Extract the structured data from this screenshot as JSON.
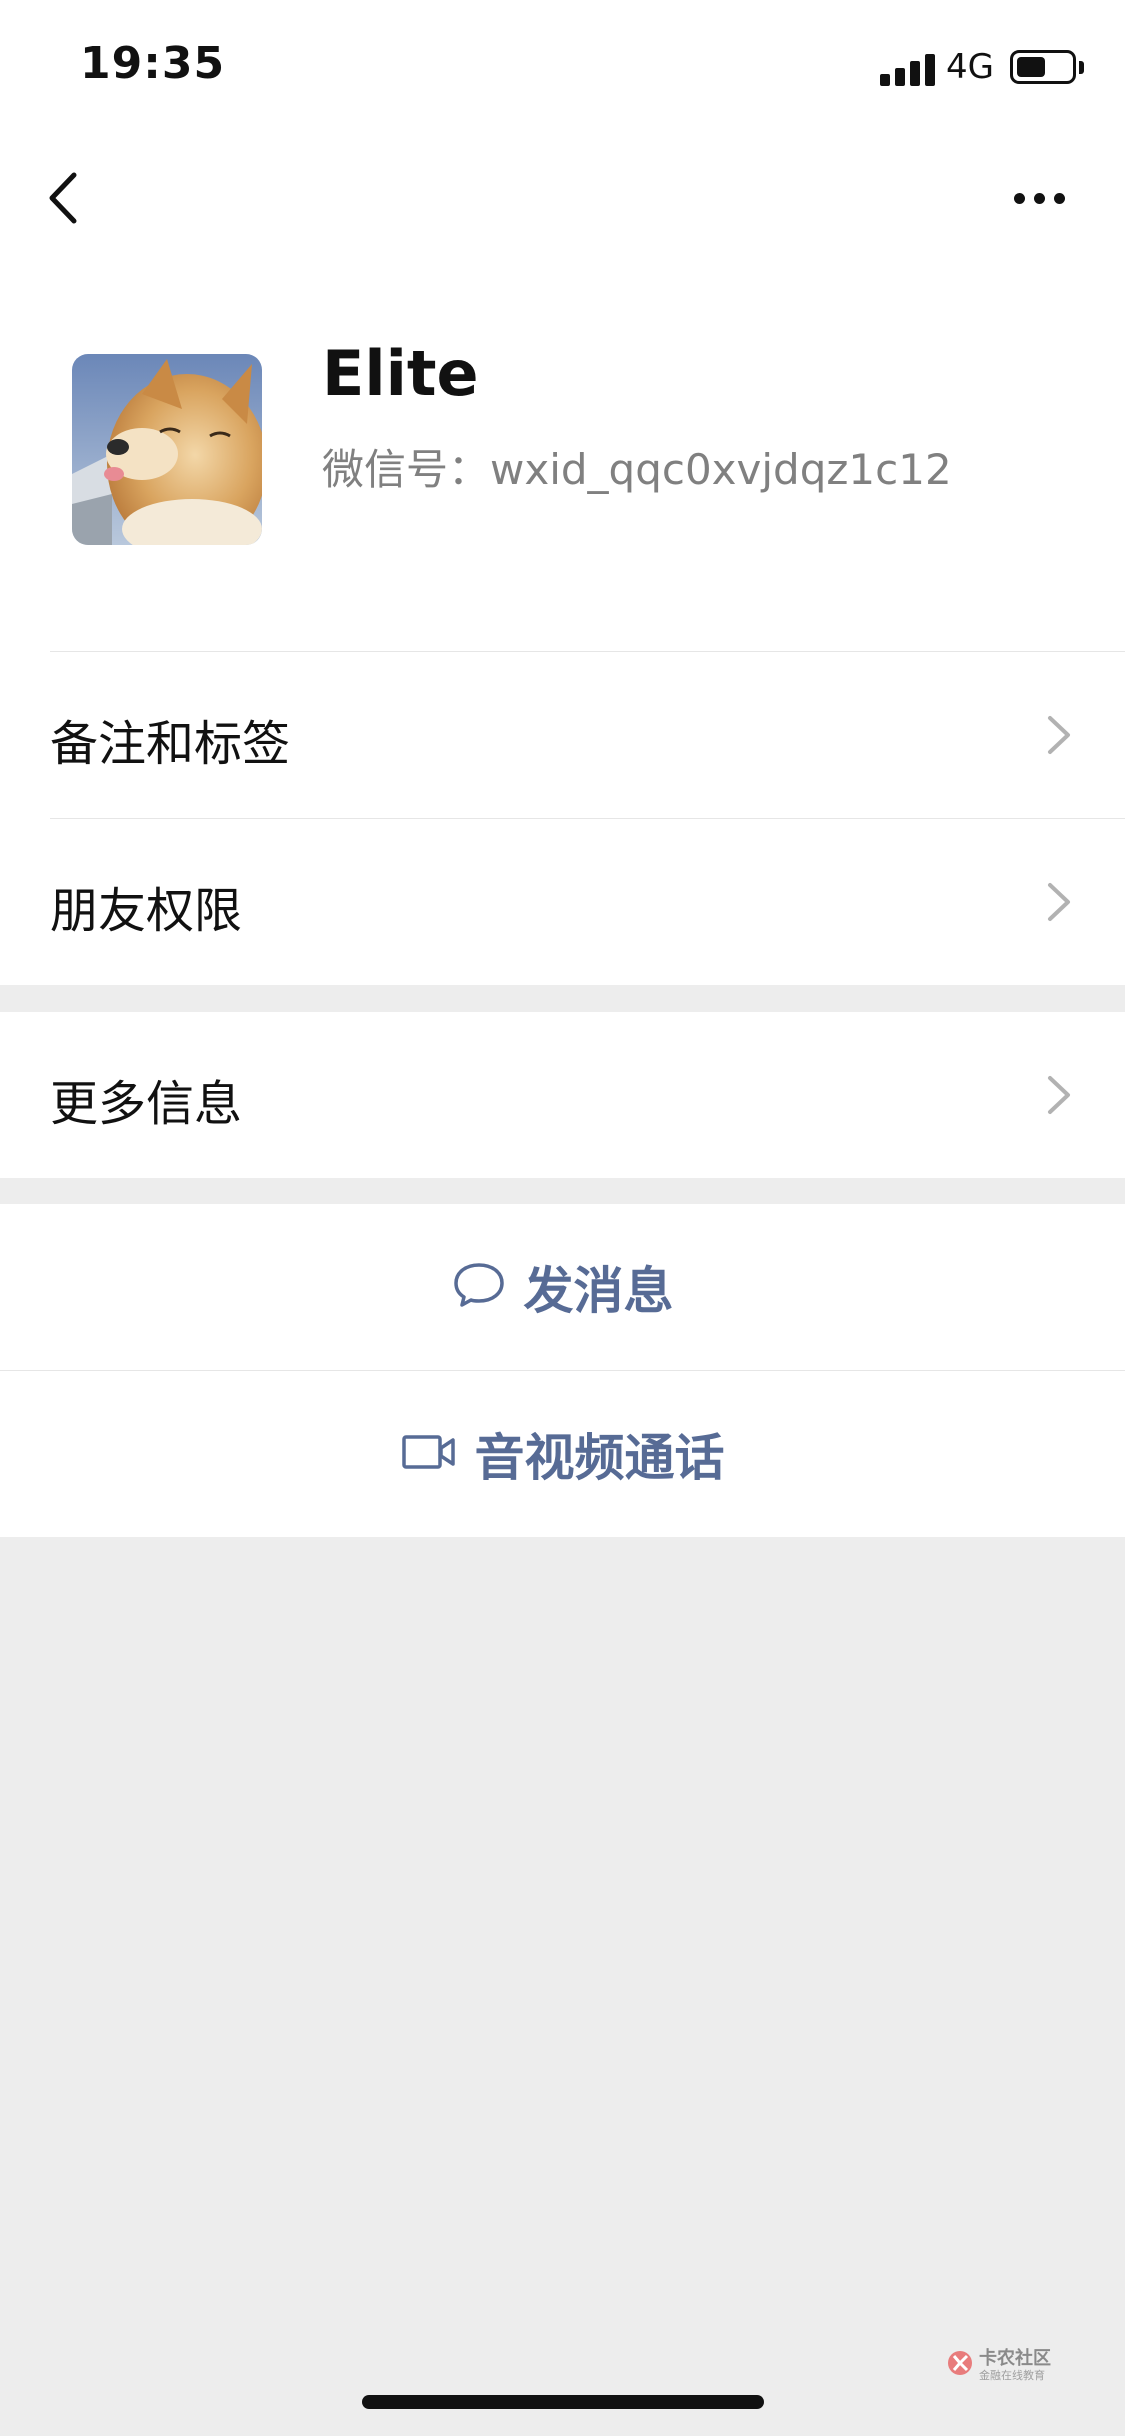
{
  "status_bar": {
    "time": "19:35",
    "network": "4G",
    "battery_level": 0.5,
    "signal_bars": 4
  },
  "nav": {
    "back_icon": "chevron-left-icon",
    "more_icon": "more-dots-icon"
  },
  "profile": {
    "name": "Elite",
    "wechat_id": "微信号：wxid_qqc0xvjdqz1c12",
    "avatar_description": "avatar"
  },
  "menu": {
    "items": [
      {
        "label": "备注和标签"
      },
      {
        "label": "朋友权限"
      },
      {
        "label": "更多信息"
      }
    ]
  },
  "actions": {
    "send_message": "发消息",
    "send_message_icon": "chat-bubble-icon",
    "call": "音视频通话",
    "call_icon": "video-camera-icon"
  },
  "watermark": {
    "title": "卡农社区",
    "subtitle": "金融在线教育"
  },
  "colors": {
    "link_blue": "#576b95",
    "background_gray": "#ededed",
    "text_secondary": "#808080"
  }
}
